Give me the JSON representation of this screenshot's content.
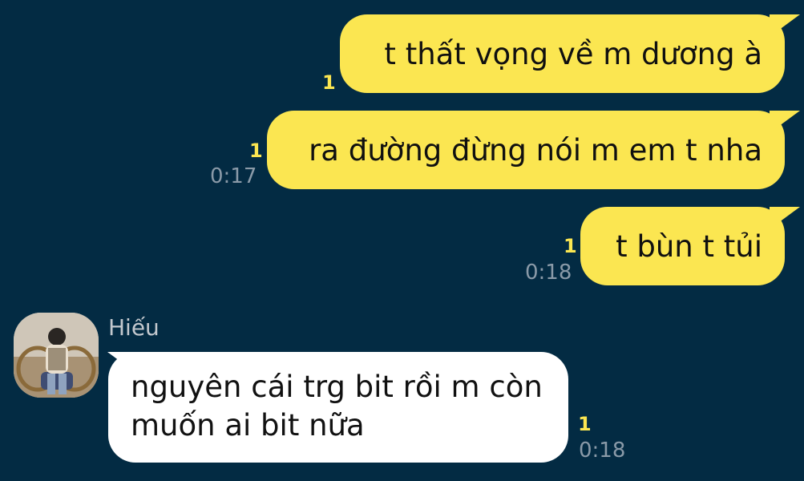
{
  "colors": {
    "background": "#032b43",
    "outgoing_bubble": "#fbe651",
    "incoming_bubble": "#ffffff",
    "read_count": "#fbe651",
    "timestamp": "#8a9aa8",
    "sender_name": "#c3c8ce"
  },
  "messages": [
    {
      "id": "m1",
      "direction": "out",
      "text": "t thất vọng về m dương à",
      "read_count": "1",
      "time": ""
    },
    {
      "id": "m2",
      "direction": "out",
      "text": "ra đường đừng nói m em t nha",
      "read_count": "1",
      "time": "0:17"
    },
    {
      "id": "m3",
      "direction": "out",
      "text": "t bùn t tủi",
      "read_count": "1",
      "time": "0:18"
    },
    {
      "id": "m4",
      "direction": "in",
      "sender": "Hiếu",
      "text": "nguyên cái trg bit rồi m còn muốn ai bit nữa",
      "read_count": "1",
      "time": "0:18"
    }
  ],
  "avatar": {
    "icon": "person-photo-avatar"
  }
}
